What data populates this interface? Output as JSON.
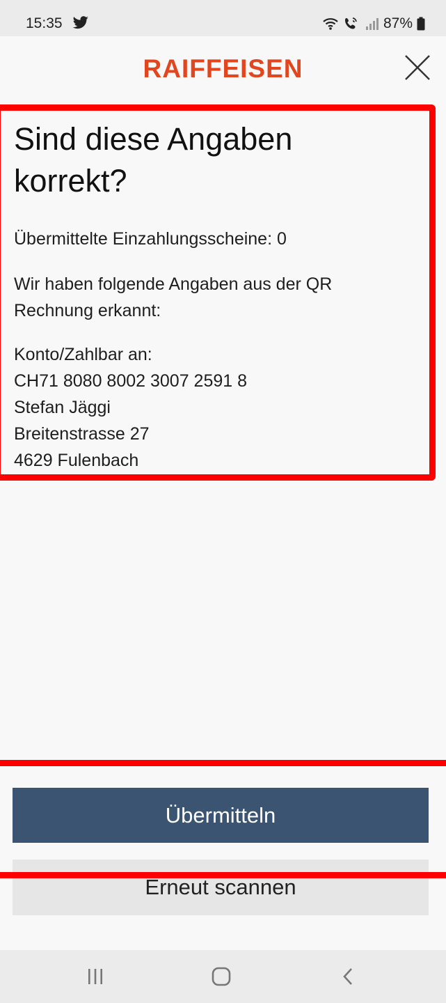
{
  "status_bar": {
    "time": "15:35",
    "battery": "87%",
    "icons": [
      "twitter-icon",
      "wifi-icon",
      "call-icon",
      "signal-icon",
      "battery-icon"
    ]
  },
  "header": {
    "brand": "RAIFFEISEN",
    "brand_color": "#e2461f",
    "close_icon": "close-icon"
  },
  "main": {
    "title_line1": "Sind diese Angaben",
    "title_line2": "korrekt?",
    "count_text": "Übermittelte Einzahlungsscheine: 0",
    "intro_line1": "Wir haben folgende Angaben aus der QR",
    "intro_line2": "Rechnung erkannt:",
    "address": {
      "label": "Konto/Zahlbar an:",
      "iban": "CH71 8080 8002 3007 2591 8",
      "name": "Stefan Jäggi",
      "street": "Breitenstrasse 27",
      "city": "4629 Fulenbach"
    }
  },
  "actions": {
    "primary_label": "Übermitteln",
    "primary_color": "#3a5471",
    "secondary_label": "Erneut scannen"
  },
  "nav": {
    "items": [
      "recent-apps-icon",
      "home-icon",
      "back-icon"
    ]
  },
  "highlight_color": "#ff0000"
}
